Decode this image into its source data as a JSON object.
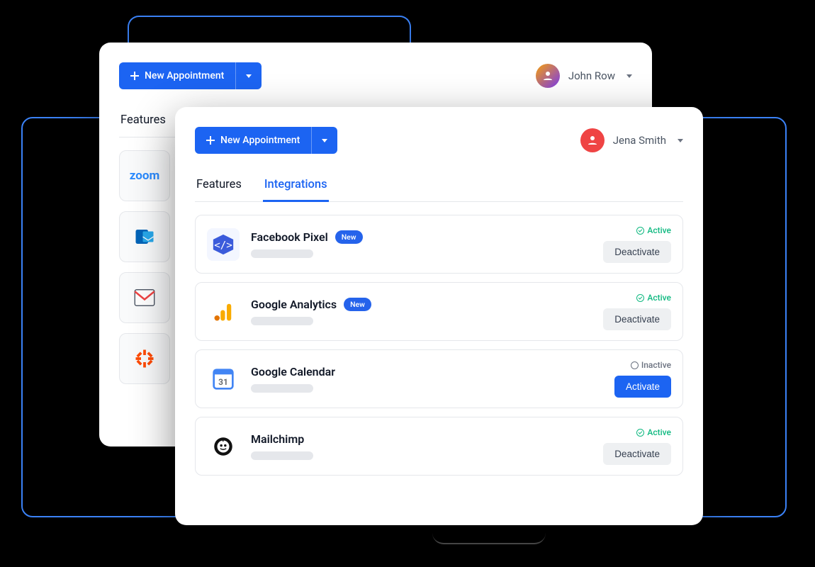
{
  "buttons": {
    "new_appointment": "New Appointment",
    "deactivate": "Deactivate",
    "activate": "Activate"
  },
  "badges": {
    "new": "New"
  },
  "status_labels": {
    "active": "Active",
    "inactive": "Inactive"
  },
  "tabs": {
    "features": "Features",
    "integrations": "Integrations"
  },
  "back_window": {
    "user_name": "John Row",
    "active_tab": "features",
    "side_icons": [
      "zoom",
      "outlook",
      "mail",
      "zapier"
    ]
  },
  "front_window": {
    "user_name": "Jena Smith",
    "active_tab": "integrations",
    "integrations": [
      {
        "id": "facebook-pixel",
        "name": "Facebook Pixel",
        "badge": "new",
        "status": "active",
        "action": "deactivate",
        "icon_bg": "#3b5998"
      },
      {
        "id": "google-analytics",
        "name": "Google Analytics",
        "badge": "new",
        "status": "active",
        "action": "deactivate",
        "icon_bg": "#f59e0b"
      },
      {
        "id": "google-calendar",
        "name": "Google Calendar",
        "badge": null,
        "status": "inactive",
        "action": "activate",
        "icon_bg": "#ffffff"
      },
      {
        "id": "mailchimp",
        "name": "Mailchimp",
        "badge": null,
        "status": "active",
        "action": "deactivate",
        "icon_bg": "#111111"
      }
    ]
  },
  "colors": {
    "primary": "#1C64F2",
    "success": "#10b981",
    "muted": "#6b7280"
  }
}
